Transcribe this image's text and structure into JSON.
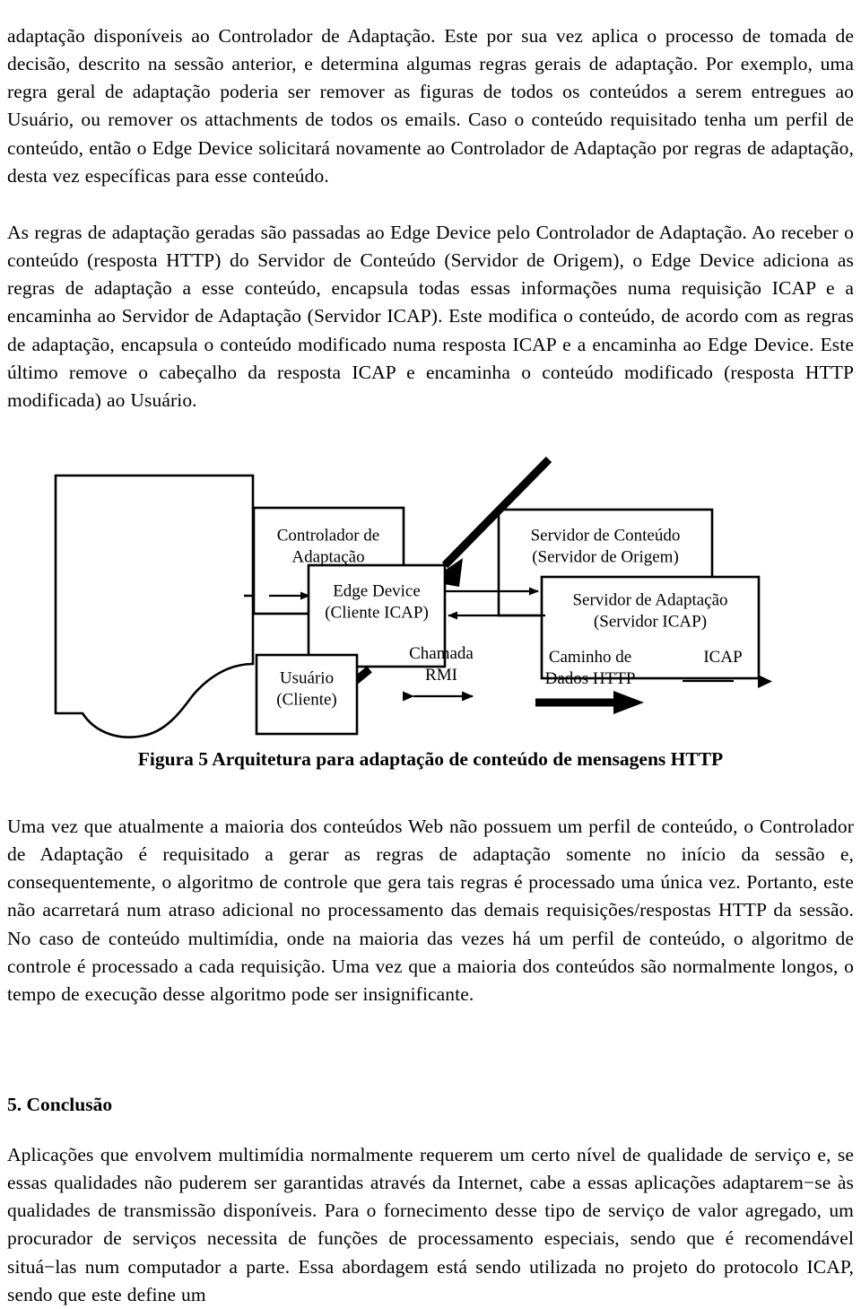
{
  "document": {
    "paragraphs": [
      "adaptação disponíveis ao Controlador de Adaptação. Este por sua vez aplica o processo de tomada de decisão, descrito na sessão anterior, e determina algumas regras gerais de adaptação. Por exemplo, uma regra geral de adaptação poderia ser remover as figuras de todos os conteúdos a serem entregues ao Usuário, ou remover os attachments de todos os emails. Caso o conteúdo requisitado tenha um perfil de conteúdo, então o Edge Device solicitará novamente ao Controlador de Adaptação por regras de adaptação, desta vez específicas para esse conteúdo.",
      "As regras de adaptação geradas são passadas ao Edge Device pelo Controlador de Adaptação. Ao receber o conteúdo (resposta HTTP) do Servidor de Conteúdo (Servidor de Origem), o Edge Device adiciona as regras de adaptação a esse conteúdo, encapsula todas essas informações numa requisição ICAP e a encaminha ao Servidor de Adaptação (Servidor ICAP). Este modifica o conteúdo, de acordo com as regras de adaptação, encapsula o conteúdo modificado numa resposta ICAP e a encaminha ao Edge Device. Este último remove o cabeçalho da resposta ICAP e encaminha o conteúdo modificado (resposta HTTP modificada) ao Usuário.",
      "Uma vez que atualmente a maioria dos conteúdos Web não possuem um perfil de conteúdo, o Controlador de Adaptação é requisitado a gerar as regras de adaptação somente no início da sessão e, consequentemente, o algoritmo de controle que gera tais regras é processado uma única vez. Portanto, este não acarretará num atraso adicional no processamento das demais requisições/respostas HTTP da sessão. No caso de conteúdo multimídia, onde na maioria das vezes há um perfil de conteúdo, o algoritmo de controle é processado a cada requisição. Uma vez que a maioria dos conteúdos são normalmente longos, o tempo de execução desse algoritmo pode ser insignificante.",
      "Aplicações que envolvem multimídia normalmente requerem um certo nível de qualidade de serviço e, se essas qualidades não puderem ser garantidas através da Internet, cabe a essas aplicações adaptarem−se às qualidades de transmissão disponíveis. Para o fornecimento desse tipo de serviço de valor agregado, um procurador de serviços necessita de funções de processamento especiais, sendo que é recomendável situá−las num computador a parte. Essa abordagem está sendo utilizada no projeto do protocolo ICAP, sendo que este define um"
    ],
    "section_heading": "5. Conclusão",
    "figure": {
      "caption": "Figura 5 Arquitetura para adaptação de conteúdo de mensagens HTTP",
      "boxes": [
        {
          "id": "controlador",
          "line1": "Controlador de",
          "line2": "Adaptação"
        },
        {
          "id": "edge-device",
          "line1": "Edge Device",
          "line2": "(Cliente ICAP)"
        },
        {
          "id": "usuario",
          "line1": "Usuário",
          "line2": "(Cliente)"
        },
        {
          "id": "servidor-conteudo",
          "line1": "Servidor de Conteúdo",
          "line2": "(Servidor de Origem)"
        },
        {
          "id": "servidor-adaptacao",
          "line1": "Servidor de Adaptação",
          "line2": "(Servidor ICAP)"
        }
      ],
      "legend": [
        {
          "id": "rmi",
          "line1": "Chamada",
          "line2": "RMI",
          "style": "double-headed-thin-arrow"
        },
        {
          "id": "http",
          "line1": "Caminho de",
          "line2": "Dados HTTP",
          "style": "thick-arrow"
        },
        {
          "id": "icap",
          "line1": "ICAP",
          "line2": "",
          "style": "thin-line-with-arrowhead"
        }
      ]
    }
  }
}
